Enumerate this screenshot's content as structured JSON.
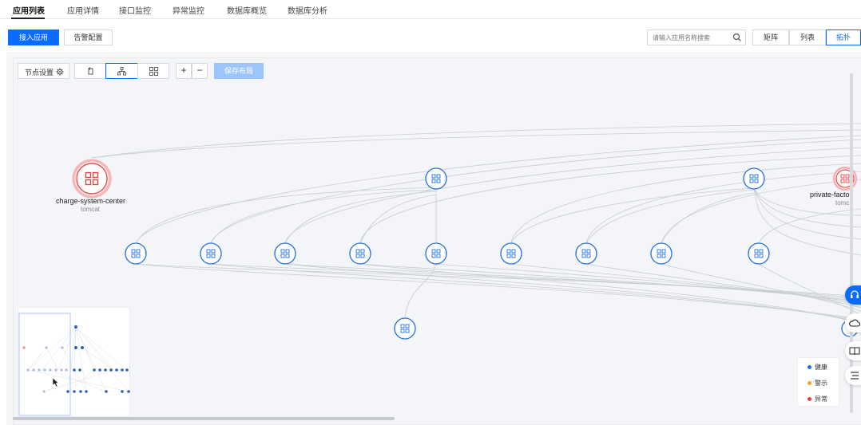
{
  "tabs": [
    {
      "label": "应用列表",
      "active": true
    },
    {
      "label": "应用详情",
      "active": false
    },
    {
      "label": "接口监控",
      "active": false
    },
    {
      "label": "异常监控",
      "active": false
    },
    {
      "label": "数据库概览",
      "active": false
    },
    {
      "label": "数据库分析",
      "active": false
    }
  ],
  "actions": {
    "import_label": "接入应用",
    "alert_label": "告警配置"
  },
  "search": {
    "placeholder": "请输入应用名称搜索"
  },
  "view_modes": [
    {
      "label": "矩阵",
      "active": false
    },
    {
      "label": "列表",
      "active": false
    },
    {
      "label": "拓扑",
      "active": true
    }
  ],
  "graph_toolbar": {
    "node_settings_label": "节点设置",
    "save_layout_label": "保存布局",
    "zoom_in": "+",
    "zoom_out": "−"
  },
  "nodes": {
    "charge": {
      "name": "charge-system-center",
      "type": "tomcat",
      "status": "error"
    },
    "private": {
      "name": "private-facto",
      "type": "tomc",
      "status": "error"
    }
  },
  "legend": [
    {
      "label": "健康",
      "color": "#1f6fe5"
    },
    {
      "label": "警示",
      "color": "#f5a623"
    },
    {
      "label": "异常",
      "color": "#e8403d"
    }
  ],
  "colors": {
    "accent": "#0a6cff",
    "healthy": "#1f6fe5",
    "error": "#e8403d"
  },
  "icons": {
    "search": "search-icon",
    "gear": "gear-icon",
    "refresh": "refresh-icon",
    "hierarchy": "hierarchy-layout-icon",
    "grid": "grid-layout-icon",
    "support": "headset-icon",
    "cloud": "cloud-icon",
    "book": "book-icon",
    "list": "list-icon"
  }
}
